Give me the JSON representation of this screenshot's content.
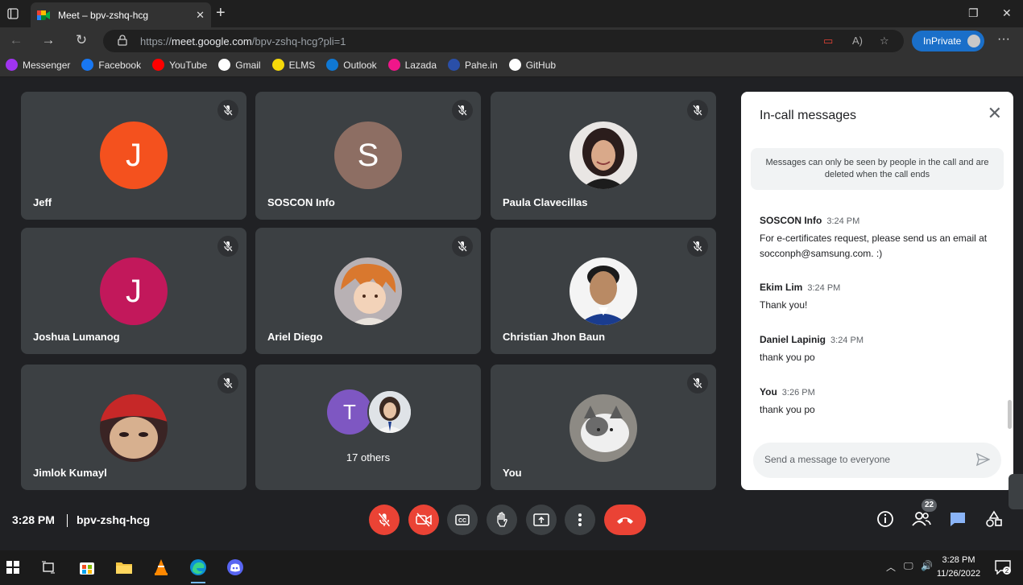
{
  "browser": {
    "tab_title": "Meet – bpv-zshq-hcg",
    "url_prefix": "https://",
    "url_host": "meet.google.com",
    "url_path": "/bpv-zshq-hcg?pli=1",
    "inprivate_label": "InPrivate",
    "bookmarks": [
      {
        "label": "Messenger",
        "icon": "messenger-icon",
        "color": "#a034f0"
      },
      {
        "label": "Facebook",
        "icon": "facebook-icon",
        "color": "#1877f2"
      },
      {
        "label": "YouTube",
        "icon": "youtube-icon",
        "color": "#ff0000"
      },
      {
        "label": "Gmail",
        "icon": "google-icon",
        "color": "#ffffff"
      },
      {
        "label": "ELMS",
        "icon": "elms-icon",
        "color": "#f5d90a"
      },
      {
        "label": "Outlook",
        "icon": "outlook-icon",
        "color": "#0f78d4"
      },
      {
        "label": "Lazada",
        "icon": "lazada-icon",
        "color": "#f0168a"
      },
      {
        "label": "Pahe.in",
        "icon": "pahe-icon",
        "color": "#2a4fa8"
      },
      {
        "label": "GitHub",
        "icon": "github-icon",
        "color": "#ffffff"
      }
    ]
  },
  "participants": [
    {
      "name": "Jeff",
      "initial": "J",
      "color": "#f4511e",
      "type": "initial"
    },
    {
      "name": "SOSCON Info",
      "initial": "S",
      "color": "#8d6e63",
      "type": "initial"
    },
    {
      "name": "Paula Clavecillas",
      "initial": "",
      "color": "#3e2a2a",
      "type": "photo"
    },
    {
      "name": "Joshua Lumanog",
      "initial": "J",
      "color": "#c2185b",
      "type": "initial"
    },
    {
      "name": "Ariel Diego",
      "initial": "",
      "color": "#d9a07a",
      "type": "photo"
    },
    {
      "name": "Christian Jhon Baun",
      "initial": "",
      "color": "#f2f2f2",
      "type": "photo"
    },
    {
      "name": "Jimlok Kumayl",
      "initial": "",
      "color": "#7a5a4a",
      "type": "photo"
    },
    {
      "name": "You",
      "initial": "",
      "color": "#a3a09a",
      "type": "photo"
    }
  ],
  "others": {
    "initial": "T",
    "label": "17 others"
  },
  "chat": {
    "title": "In-call messages",
    "notice": "Messages can only be seen by people in the call and are deleted when the call ends",
    "messages": [
      {
        "sender": "SOSCON Info",
        "time": "3:24 PM",
        "text": "For e-certificates request, please send us an email at socconph@samsung.com. :)"
      },
      {
        "sender": "Ekim Lim",
        "time": "3:24 PM",
        "text": "Thank you!"
      },
      {
        "sender": "Daniel Lapinig",
        "time": "3:24 PM",
        "text": "thank you po"
      },
      {
        "sender": "You",
        "time": "3:26 PM",
        "text": "thank you po"
      }
    ],
    "placeholder": "Send a message to everyone"
  },
  "controls": {
    "time": "3:28 PM",
    "meeting_code": "bpv-zshq-hcg",
    "people_count": "22"
  },
  "taskbar": {
    "time": "3:28 PM",
    "date": "11/26/2022",
    "notifications": "2"
  },
  "colors": {
    "meet_bg": "#202124",
    "tile_bg": "#3c4043",
    "danger": "#ea4335",
    "accent": "#8ab4f8"
  }
}
